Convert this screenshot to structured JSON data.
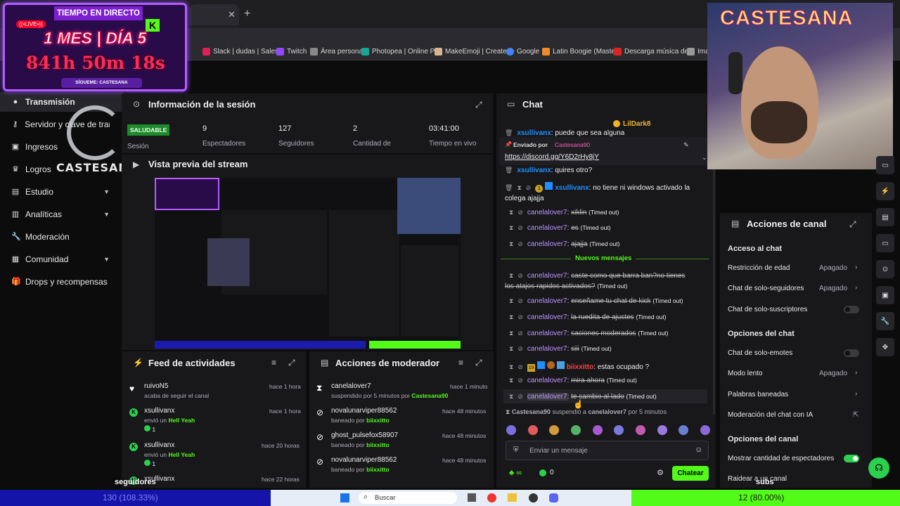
{
  "browser": {
    "bookmarks": [
      "Slack | dudas | Sales...",
      "Twitch",
      "Área personal",
      "Photopea | Online P...",
      "MakeEmoji | Create...",
      "Google",
      "Latin Boogie (Maste...",
      "Descarga música de...",
      "Imag"
    ]
  },
  "overlay": {
    "title": "TIEMPO EN DIRECTO",
    "live": "((•LIVE•))",
    "duration": "1 MES | DÍA 5",
    "timer": "841h 50m 18s",
    "follow": "SÍGUEME: CASTESANA",
    "brand": "CASTESANA",
    "webcam_brand": "CASTESANA",
    "followers_label": "seguidores",
    "followers_bar": "130 (108.33%)",
    "subs_label": "subs",
    "subs_bar": "12 (80.00%)"
  },
  "sidebar": {
    "items": [
      {
        "label": "Transmisión",
        "icon": "broadcast-icon"
      },
      {
        "label": "Servidor y clave de transmisión",
        "icon": "key-icon"
      },
      {
        "label": "Ingresos",
        "icon": "revenue-icon"
      },
      {
        "label": "Logros",
        "icon": "trophy-icon"
      },
      {
        "label": "Estudio",
        "icon": "studio-icon"
      },
      {
        "label": "Analíticas",
        "icon": "analytics-icon"
      },
      {
        "label": "Moderación",
        "icon": "wrench-icon"
      },
      {
        "label": "Comunidad",
        "icon": "community-icon"
      },
      {
        "label": "Drops y recompensas",
        "icon": "gift-icon"
      }
    ]
  },
  "session": {
    "title": "Información de la sesión",
    "health": "SALUDABLE",
    "health_label": "Sesión",
    "stats": [
      {
        "value": "9",
        "label": "Espectadores"
      },
      {
        "value": "127",
        "label": "Seguidores"
      },
      {
        "value": "2",
        "label": "Cantidad de"
      },
      {
        "value": "03:41:00",
        "label": "Tiempo en vivo"
      }
    ]
  },
  "preview": {
    "title": "Vista previa del stream"
  },
  "feed": {
    "title": "Feed de actividades",
    "items": [
      {
        "name": "ruivoN5",
        "sub": "acaba de seguir el canal",
        "time": "hace 1 hora",
        "extra": ""
      },
      {
        "name": "xsullivanx",
        "sub": "envió un",
        "link": "Hell Yeah",
        "time": "hace 1 hora",
        "extra": "1"
      },
      {
        "name": "xsullivanx",
        "sub": "envió un",
        "link": "Hell Yeah",
        "time": "hace 20 horas",
        "extra": "1"
      },
      {
        "name": "xsullivanx",
        "sub": "",
        "link": "",
        "time": "hace 22 horas",
        "extra": ""
      }
    ]
  },
  "modactions": {
    "title": "Acciones de moderador",
    "items": [
      {
        "name": "canelalover7",
        "sub": "suspendido por 5 minutos por",
        "by": "Castesana90",
        "time": "hace 1 minuto"
      },
      {
        "name": "novalunarviper88562",
        "sub": "baneado por",
        "by": "biixxitto",
        "time": "hace 48 minutos"
      },
      {
        "name": "ghost_pulsefox58907",
        "sub": "baneado por",
        "by": "biixxitto",
        "time": "hace 48 minutos"
      },
      {
        "name": "novalunarviper88562",
        "sub": "baneado por",
        "by": "biixxitto",
        "time": "hace 48 minutos"
      }
    ]
  },
  "chat": {
    "title": "Chat",
    "pinned_user": "LilDark8",
    "pinned_sent_label": "Enviado por",
    "pinned_sender": "Castesana90",
    "pinned_link": "https://discord.gg/Y6D2rHy8jY",
    "top_partial_user": "xsullivanx",
    "top_partial_text": "puede que sea alguna",
    "partial2_user": "xsullivanx",
    "partial2_text": "quires otro?",
    "messages": [
      {
        "user": "xsullivanx",
        "text": "no tiene ni windows activado la",
        "cont": "colega ajajja",
        "timed": "",
        "struck": false,
        "color": "blue"
      },
      {
        "user": "canelalover7",
        "text": "xiklin",
        "timed": "(Timed out)",
        "struck": true
      },
      {
        "user": "canelalover7",
        "text": "es",
        "timed": "(Timed out)",
        "struck": true
      },
      {
        "user": "canelalover7",
        "text": "ajajja",
        "timed": "(Timed out)",
        "struck": true
      }
    ],
    "new_messages": "Nuevos mensajes",
    "messages2": [
      {
        "user": "canelalover7",
        "text": "caste como que barra ban?no tienes",
        "cont": "los atajos rapidos activados?",
        "timed": "(Timed out)"
      },
      {
        "user": "canelalover7",
        "text": "enseñame tu chat de kick",
        "timed": "(Timed out)"
      },
      {
        "user": "canelalover7",
        "text": "la ruedita de ajustes",
        "timed": "(Timed out)"
      },
      {
        "user": "canelalover7",
        "text": "saciones moderados",
        "timed": "(Timed out)"
      },
      {
        "user": "canelalover7",
        "text": "siii",
        "timed": "(Timed out)"
      },
      {
        "user": "biixxitto",
        "text": "estas ocupado ?",
        "timed": ""
      },
      {
        "user": "canelalover7",
        "text": "mira ahora",
        "timed": "(Timed out)"
      },
      {
        "user": "canelalover7",
        "text": "te cambio al lado",
        "timed": "(Timed out)"
      }
    ],
    "suspend_notice_user": "Castesana90",
    "suspend_notice_mid": "suspendió a",
    "suspend_notice_target": "canelalover7",
    "suspend_notice_end": "por 5 minutos",
    "placeholder": "Enviar un mensaje",
    "points": "0",
    "send_label": "Chatear",
    "badge_19": "19",
    "badge_1": "1"
  },
  "channel_actions": {
    "title": "Acciones de canal",
    "chat_access": "Acceso al chat",
    "age": {
      "label": "Restricción de edad",
      "value": "Apagado"
    },
    "followers_only": {
      "label": "Chat de solo-seguidores",
      "value": "Apagado"
    },
    "subs_only": {
      "label": "Chat de solo-suscriptores"
    },
    "chat_options": "Opciones del chat",
    "emotes_only": {
      "label": "Chat de solo-emotes"
    },
    "slow": {
      "label": "Modo lento",
      "value": "Apagado"
    },
    "banned_words": {
      "label": "Palabras baneadas"
    },
    "ai_mod": {
      "label": "Moderación del chat con IA"
    },
    "channel_options": "Opciones del canal",
    "show_viewers": {
      "label": "Mostrar cantidad de espectadores",
      "on": true
    },
    "raid": {
      "label": "Raidear a un canal"
    }
  },
  "taskbar": {
    "search": "Buscar"
  },
  "colors": {
    "accent": "#53fc18",
    "twitch_purple": "#9147ff",
    "panel": "#18181b",
    "username": "#bf94ff"
  }
}
